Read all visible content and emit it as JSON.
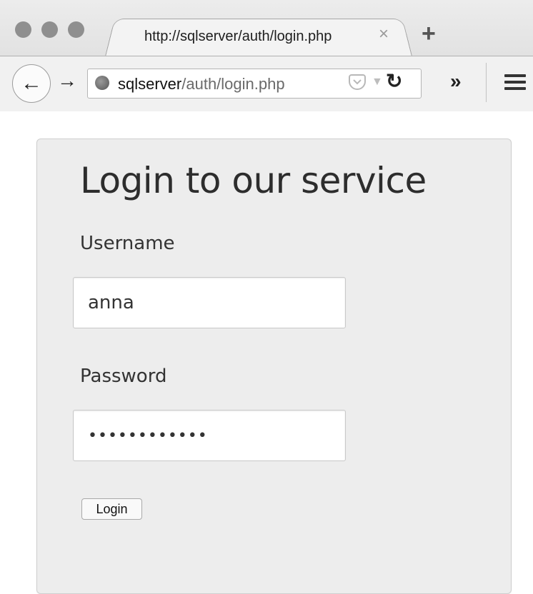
{
  "browser": {
    "tab_title": "http://sqlserver/auth/login.php",
    "tab_close": "×",
    "new_tab": "+",
    "back": "←",
    "forward": "→",
    "url_host": "sqlserver",
    "url_path": "/auth/login.php",
    "reload": "↻",
    "overflow": "»",
    "icons": [
      "back-icon",
      "forward-icon",
      "globe-icon",
      "pocket-icon",
      "reload-icon",
      "overflow-icon",
      "menu-icon"
    ]
  },
  "page": {
    "heading": "Login to our service",
    "username_label": "Username",
    "username_value": "anna",
    "password_label": "Password",
    "password_value": "••••••••••••",
    "login_button": "Login"
  }
}
